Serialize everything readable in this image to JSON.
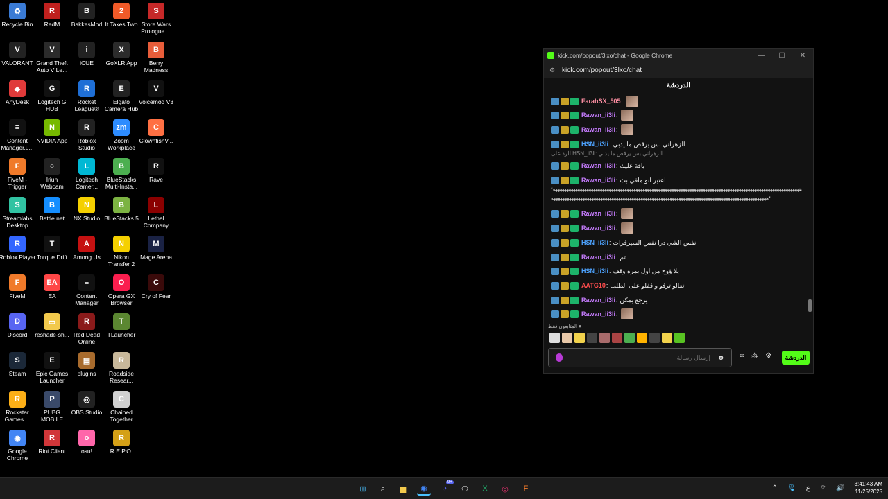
{
  "desktop": {
    "icons": [
      {
        "label": "Recycle Bin",
        "color": "#3a7bd5",
        "glyph": "♻"
      },
      {
        "label": "VALORANT",
        "color": "#222222",
        "glyph": "V"
      },
      {
        "label": "AnyDesk",
        "color": "#e03a3a",
        "glyph": "◆"
      },
      {
        "label": "Content\nManager.u...",
        "color": "#111111",
        "glyph": "≡"
      },
      {
        "label": "FiveM -\nTrigger",
        "color": "#f07a2a",
        "glyph": "F"
      },
      {
        "label": "Streamlabs\nDesktop",
        "color": "#31c3a2",
        "glyph": "S"
      },
      {
        "label": "Roblox Player",
        "color": "#3366ff",
        "glyph": "R"
      },
      {
        "label": "FiveM",
        "color": "#f07a2a",
        "glyph": "F"
      },
      {
        "label": "Discord",
        "color": "#5865f2",
        "glyph": "D"
      },
      {
        "label": "Steam",
        "color": "#1b2838",
        "glyph": "S"
      },
      {
        "label": "Rockstar\nGames ...",
        "color": "#fcaf17",
        "glyph": "R"
      },
      {
        "label": "Google\nChrome",
        "color": "#4285f4",
        "glyph": "◉"
      },
      {
        "label": "RedM",
        "color": "#c0201e",
        "glyph": "R"
      },
      {
        "label": "Grand Theft\nAuto V Le...",
        "color": "#2b2b2b",
        "glyph": "V"
      },
      {
        "label": "Logitech G\nHUB",
        "color": "#111111",
        "glyph": "G"
      },
      {
        "label": "NVIDIA App",
        "color": "#76b900",
        "glyph": "N"
      },
      {
        "label": "Iriun\nWebcam",
        "color": "#222222",
        "glyph": "○"
      },
      {
        "label": "Battle.net",
        "color": "#148eff",
        "glyph": "B"
      },
      {
        "label": "Torque Drift",
        "color": "#111111",
        "glyph": "T"
      },
      {
        "label": "EA",
        "color": "#ff4747",
        "glyph": "EA"
      },
      {
        "label": "reshade-sh...",
        "color": "#f2c94c",
        "glyph": "▭"
      },
      {
        "label": "Epic Games\nLauncher",
        "color": "#111111",
        "glyph": "E"
      },
      {
        "label": "PUBG\nMOBILE",
        "color": "#3a4a6a",
        "glyph": "P"
      },
      {
        "label": "Riot Client",
        "color": "#d13639",
        "glyph": "R"
      },
      {
        "label": "BakkesMod",
        "color": "#222222",
        "glyph": "B"
      },
      {
        "label": "iCUE",
        "color": "#222222",
        "glyph": "i"
      },
      {
        "label": "Rocket\nLeague®",
        "color": "#1f6fd6",
        "glyph": "R"
      },
      {
        "label": "Roblox\nStudio",
        "color": "#222222",
        "glyph": "R"
      },
      {
        "label": "Logitech\nCamer...",
        "color": "#00b8d4",
        "glyph": "L"
      },
      {
        "label": "NX Studio",
        "color": "#f5d000",
        "glyph": "N"
      },
      {
        "label": "Among Us",
        "color": "#c51111",
        "glyph": "A"
      },
      {
        "label": "Content\nManager",
        "color": "#111111",
        "glyph": "≡"
      },
      {
        "label": "Red Dead\nOnline",
        "color": "#8a1a1a",
        "glyph": "R"
      },
      {
        "label": "plugins",
        "color": "#a86b2d",
        "glyph": "▤"
      },
      {
        "label": "OBS Studio",
        "color": "#222222",
        "glyph": "◎"
      },
      {
        "label": "osu!",
        "color": "#ff66aa",
        "glyph": "o"
      },
      {
        "label": "It Takes Two",
        "color": "#f05a28",
        "glyph": "2"
      },
      {
        "label": "GoXLR App",
        "color": "#2b2b2b",
        "glyph": "X"
      },
      {
        "label": "Elgato\nCamera Hub",
        "color": "#222222",
        "glyph": "E"
      },
      {
        "label": "Zoom\nWorkplace",
        "color": "#2d8cff",
        "glyph": "zm"
      },
      {
        "label": "BlueStacks\nMulti-Insta...",
        "color": "#4caf50",
        "glyph": "B"
      },
      {
        "label": "BlueStacks 5",
        "color": "#7cb342",
        "glyph": "B"
      },
      {
        "label": "Nikon\nTransfer 2",
        "color": "#f5d000",
        "glyph": "N"
      },
      {
        "label": "Opera GX\nBrowser",
        "color": "#fa1e4e",
        "glyph": "O"
      },
      {
        "label": "TLauncher",
        "color": "#5b8731",
        "glyph": "T"
      },
      {
        "label": "Roadside\nResear...",
        "color": "#c8b89a",
        "glyph": "R"
      },
      {
        "label": "Chained\nTogether",
        "color": "#d0d0d0",
        "glyph": "C"
      },
      {
        "label": "R.E.P.O.",
        "color": "#d4a017",
        "glyph": "R"
      },
      {
        "label": "Store Wars\nPrologue ...",
        "color": "#c62828",
        "glyph": "S"
      },
      {
        "label": "Berry\nMadness",
        "color": "#e85d3a",
        "glyph": "B"
      },
      {
        "label": "Voicemod V3",
        "color": "#111111",
        "glyph": "V"
      },
      {
        "label": "ClownfishV...",
        "color": "#ff7043",
        "glyph": "C"
      },
      {
        "label": "Rave",
        "color": "#111111",
        "glyph": "R"
      },
      {
        "label": "Lethal\nCompany",
        "color": "#8b0000",
        "glyph": "L"
      },
      {
        "label": "Mage Arena",
        "color": "#1a2244",
        "glyph": "M"
      },
      {
        "label": "Cry of Fear",
        "color": "#3a0a0a",
        "glyph": "C"
      }
    ]
  },
  "window": {
    "title": "kick.com/popout/3lxo/chat - Google Chrome",
    "minimize": "—",
    "maximize": "☐",
    "close": "✕",
    "address": "kick.com/popout/3lxo/chat",
    "tune_icon": "⚙"
  },
  "chat": {
    "header": "الدردشة",
    "messages": [
      {
        "user": "FarahSX_505",
        "color": "#ff8fa3",
        "text": "",
        "thumb": true,
        "badges": [
          "blue",
          "gold",
          "green"
        ]
      },
      {
        "user": "Rawan_ii3li",
        "color": "#c77dff",
        "text": "",
        "thumb": true,
        "badges": [
          "blue",
          "gold",
          "green"
        ]
      },
      {
        "user": "Rawan_ii3li",
        "color": "#c77dff",
        "text": "",
        "thumb": true,
        "badges": [
          "blue",
          "gold",
          "green"
        ]
      },
      {
        "user": "HSN_ii3li",
        "color": "#4da3ff",
        "text": "الزهراني بس يرقص ما يدبي",
        "thumb": false,
        "badges": [
          "blue",
          "gold",
          "green"
        ]
      },
      {
        "user": "Rawan_ii3li",
        "color": "#c77dff",
        "text": "باقة عليك",
        "thumb": false,
        "badges": [
          "blue",
          "gold",
          "green"
        ]
      },
      {
        "user": "Rawan_ii3li",
        "color": "#c77dff",
        "text": "اعتبر انو مافي بث",
        "thumb": false,
        "badges": [
          "blue",
          "gold",
          "green"
        ]
      },
      {
        "user": "Rawan_ii3li",
        "color": "#c77dff",
        "text": "",
        "thumb": true,
        "badges": [
          "blue",
          "gold",
          "green"
        ]
      },
      {
        "user": "Rawan_ii3li",
        "color": "#c77dff",
        "text": "",
        "thumb": true,
        "badges": [
          "blue",
          "gold",
          "green"
        ]
      },
      {
        "user": "HSN_ii3li",
        "color": "#4da3ff",
        "text": "نفس الشي درا نفس السيرفرات",
        "thumb": false,
        "badges": [
          "blue",
          "gold",
          "green"
        ]
      },
      {
        "user": "Rawan_ii3li",
        "color": "#c77dff",
        "text": "تم",
        "thumb": false,
        "badges": [
          "blue",
          "gold",
          "green"
        ]
      },
      {
        "user": "HSN_ii3li",
        "color": "#4da3ff",
        "text": "يلا ؤوح من اول بمرة وقف",
        "thumb": false,
        "badges": [
          "blue",
          "gold",
          "green"
        ]
      },
      {
        "user": "AATG10",
        "color": "#ff4d4d",
        "text": "تعالو ترفو و قفلو على الطلب",
        "thumb": false,
        "badges": [
          "blue",
          "gold",
          "green"
        ]
      },
      {
        "user": "Rawan_ii3li",
        "color": "#c77dff",
        "text": "يرجع يمكن",
        "thumb": false,
        "badges": [
          "blue",
          "gold",
          "green"
        ]
      },
      {
        "user": "Rawan_ii3li",
        "color": "#c77dff",
        "text": "",
        "thumb": true,
        "badges": [
          "blue",
          "gold",
          "green"
        ]
      }
    ],
    "reply_text": "الرد على HSN_ii3li: الزهراني بس يرقص ما يدبي",
    "long_line_1": "*ههههههههههههههههههههههههههههههههههههههههههههههههههههههههههههههههههههههههههههههههههههههههههههههههههههههههههههههه",
    "long_line_2": "ههههههههههههههههههههههههههههههههههههههههههههههههههههههههههههههههههههههههههههههههههههههههههههههههه*",
    "subs_only": "المتابعون فقط ♥",
    "input_placeholder": "إرسال رسالة",
    "send_button": "الدردشة",
    "mic_icon": "mic-icon",
    "settings_icon": "⚙",
    "infinity_icon": "∞",
    "emote_colors": [
      "#ddd",
      "#e8c8a8",
      "#f2d24c",
      "#444",
      "#a86b6b",
      "#aa4444",
      "#4caf50",
      "#ffb300",
      "#444",
      "#f2d24c",
      "#58c322"
    ]
  },
  "taskbar": {
    "items": [
      {
        "name": "start-button",
        "glyph": "⊞",
        "color": "#4cc2ff"
      },
      {
        "name": "search-icon",
        "glyph": "⌕",
        "color": "#ffffff"
      },
      {
        "name": "file-explorer-icon",
        "glyph": "▆",
        "color": "#f2c94c"
      },
      {
        "name": "chrome-icon",
        "glyph": "◉",
        "color": "#4285f4"
      },
      {
        "name": "discord-icon",
        "glyph": "◔",
        "color": "#5865f2"
      },
      {
        "name": "chatgpt-icon",
        "glyph": "⎔",
        "color": "#cccccc"
      },
      {
        "name": "excel-icon",
        "glyph": "X",
        "color": "#21a366"
      },
      {
        "name": "instagram-icon",
        "glyph": "◎",
        "color": "#e1306c"
      },
      {
        "name": "fivem-icon",
        "glyph": "F",
        "color": "#f07a2a"
      }
    ],
    "discord_badge": "9+",
    "lang": "ع",
    "time": "3:41:43 AM",
    "date": "11/25/2025"
  }
}
